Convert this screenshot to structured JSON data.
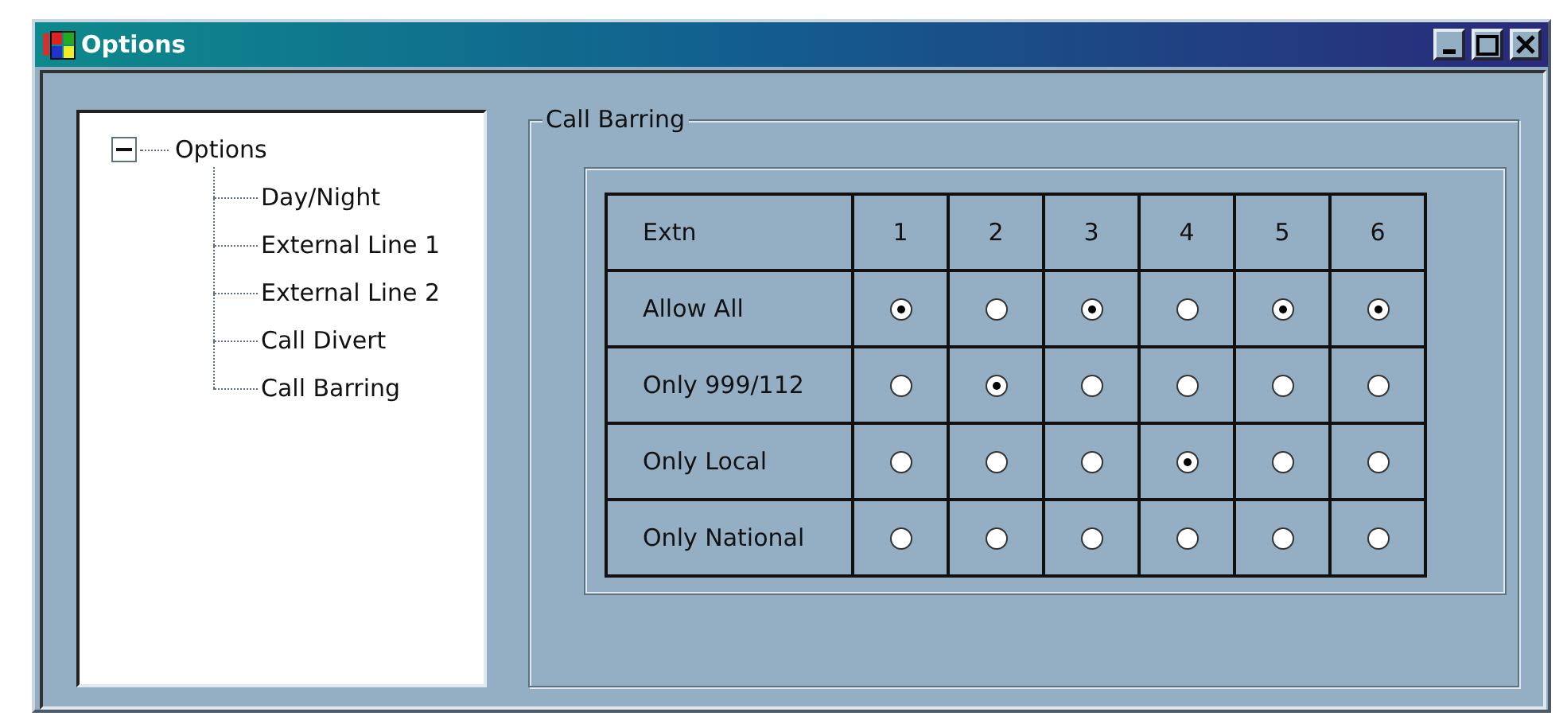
{
  "window": {
    "title": "Options"
  },
  "tree": {
    "label": "Options",
    "expanded": true,
    "children": [
      {
        "label": "Day/Night"
      },
      {
        "label": "External Line 1"
      },
      {
        "label": "External Line 2"
      },
      {
        "label": "Call Divert"
      },
      {
        "label": "Call Barring"
      }
    ]
  },
  "group": {
    "title": "Call Barring"
  },
  "table": {
    "columns": [
      "Extn",
      "1",
      "2",
      "3",
      "4",
      "5",
      "6"
    ],
    "rows": [
      {
        "label": "Allow All",
        "cells": [
          {
            "selected": true
          },
          {
            "selected": false
          },
          {
            "selected": true
          },
          {
            "selected": false
          },
          {
            "selected": true
          },
          {
            "selected": true
          }
        ]
      },
      {
        "label": "Only 999/112",
        "cells": [
          {
            "selected": false
          },
          {
            "selected": true
          },
          {
            "selected": false
          },
          {
            "selected": false
          },
          {
            "selected": false
          },
          {
            "selected": false
          }
        ]
      },
      {
        "label": "Only Local",
        "cells": [
          {
            "selected": false
          },
          {
            "selected": false
          },
          {
            "selected": false
          },
          {
            "selected": true
          },
          {
            "selected": false
          },
          {
            "selected": false
          }
        ]
      },
      {
        "label": "Only National",
        "cells": [
          {
            "selected": false
          },
          {
            "selected": false
          },
          {
            "selected": false
          },
          {
            "selected": false
          },
          {
            "selected": false
          },
          {
            "selected": false
          }
        ]
      }
    ]
  }
}
